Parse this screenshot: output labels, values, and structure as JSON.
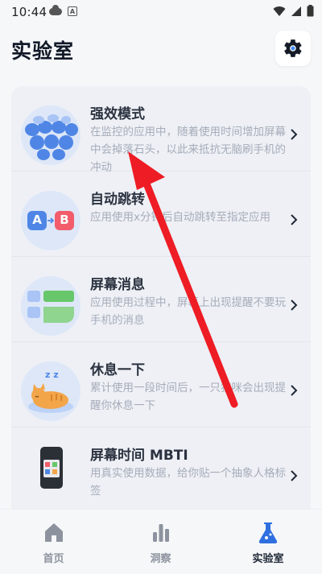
{
  "status_bar": {
    "time": "10:44"
  },
  "header": {
    "title": "实验室"
  },
  "items": [
    {
      "title": "强效模式",
      "desc": "在监控的应用中，随着使用时间增加屏幕中会掉落石头，以此来抵抗无脑刷手机的冲动"
    },
    {
      "title": "自动跳转",
      "desc": "应用使用x分钟后自动跳转至指定应用",
      "thumb_labels": [
        "A",
        "B"
      ]
    },
    {
      "title": "屏幕消息",
      "desc": "应用使用过程中，屏幕上出现提醒不要玩手机的消息"
    },
    {
      "title": "休息一下",
      "desc": "累计使用一段时间后，一只猫咪会出现提醒你休息一下",
      "thumb_text": "z z"
    },
    {
      "title": "屏幕时间 MBTI",
      "desc": "用真实使用数据，给你贴一个抽象人格标签"
    }
  ],
  "bottom_nav": [
    {
      "label": "首页",
      "icon": "home-icon",
      "active": false
    },
    {
      "label": "洞察",
      "icon": "bar-chart-icon",
      "active": false
    },
    {
      "label": "实验室",
      "icon": "flask-icon",
      "active": true
    }
  ],
  "colors": {
    "accent_blue": "#2f6fe0",
    "arrow_red": "#ee1c24",
    "card_bg": "#eef0f5",
    "desc_gray": "#a6adba"
  }
}
